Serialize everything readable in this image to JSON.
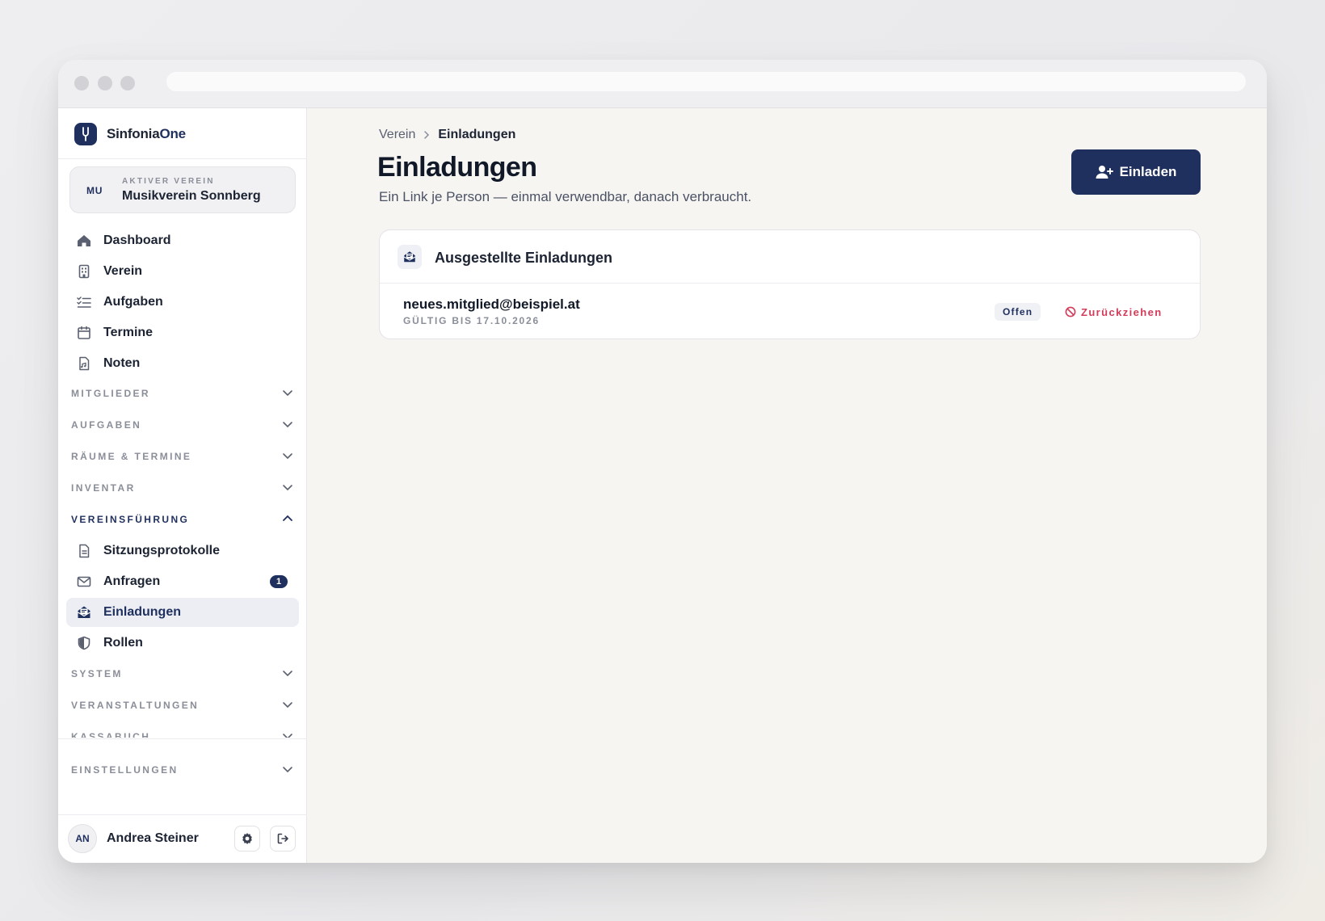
{
  "app": {
    "name_part1": "Sinfonia",
    "name_part2": "One"
  },
  "active_club": {
    "abbr": "MU",
    "label": "AKTIVER VEREIN",
    "name": "Musikverein Sonnberg"
  },
  "nav_top": [
    {
      "label": "Dashboard",
      "icon": "home-icon"
    },
    {
      "label": "Verein",
      "icon": "building-icon"
    },
    {
      "label": "Aufgaben",
      "icon": "checklist-icon"
    },
    {
      "label": "Termine",
      "icon": "calendar-icon"
    },
    {
      "label": "Noten",
      "icon": "music-sheet-icon"
    }
  ],
  "sections": {
    "mitglieder": "MITGLIEDER",
    "aufgaben": "AUFGABEN",
    "raeume": "RÄUME & TERMINE",
    "inventar": "INVENTAR",
    "vereinsfuehrung": "VEREINSFÜHRUNG",
    "system": "SYSTEM",
    "veranstaltungen": "VERANSTALTUNGEN",
    "kassabuch": "KASSABUCH",
    "einstellungen": "EINSTELLUNGEN"
  },
  "vereinsfuehrung_items": [
    {
      "label": "Sitzungsprotokolle",
      "icon": "document-icon"
    },
    {
      "label": "Anfragen",
      "icon": "mail-icon",
      "badge": "1"
    },
    {
      "label": "Einladungen",
      "icon": "invitation-icon",
      "active": true
    },
    {
      "label": "Rollen",
      "icon": "shield-icon"
    }
  ],
  "user": {
    "initials": "AN",
    "name": "Andrea Steiner"
  },
  "breadcrumb": {
    "parent": "Verein",
    "current": "Einladungen"
  },
  "page": {
    "title": "Einladungen",
    "subtitle": "Ein Link je Person — einmal verwendbar, danach verbraucht.",
    "invite_button": "Einladen"
  },
  "invitations_card": {
    "title": "Ausgestellte Einladungen",
    "items": [
      {
        "email": "neues.mitglied@beispiel.at",
        "valid_until": "GÜLTIG BIS 17.10.2026",
        "status": "Offen",
        "action": "Zurückziehen"
      }
    ]
  },
  "colors": {
    "brand": "#1f2f5e",
    "danger": "#d23c5a",
    "background": "#f6f5f2"
  }
}
